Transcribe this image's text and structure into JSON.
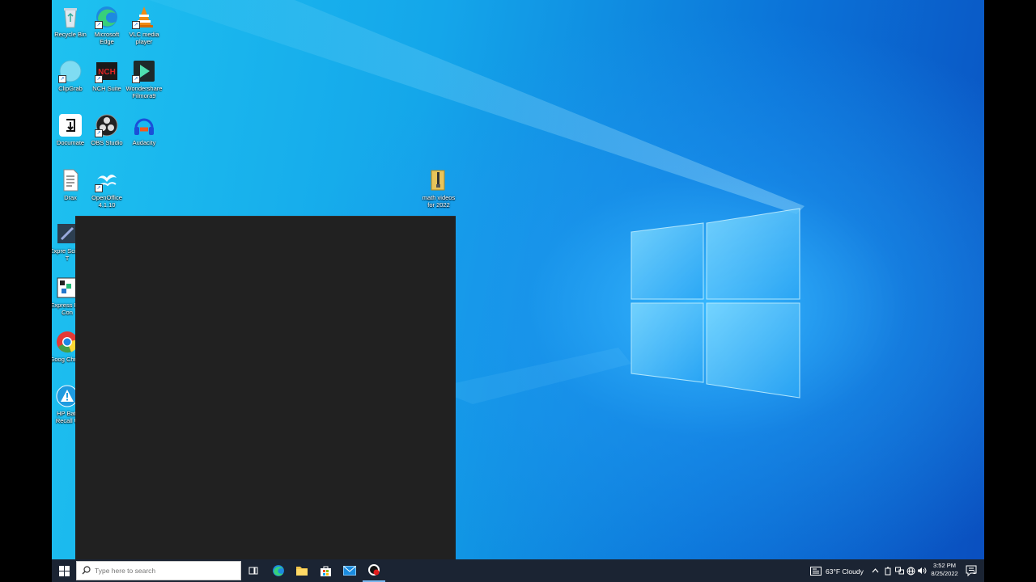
{
  "desktop": {
    "icons": [
      {
        "label": "Recycle Bin"
      },
      {
        "label": "Microsoft Edge"
      },
      {
        "label": "VLC media player"
      },
      {
        "label": "ClipGrab"
      },
      {
        "label": "NCH Suite"
      },
      {
        "label": "Wondershare Filmora9"
      },
      {
        "label": "Documate"
      },
      {
        "label": "OBS Studio"
      },
      {
        "label": "Audacity"
      },
      {
        "label": "Drax"
      },
      {
        "label": "OpenOffice 4.1.10"
      },
      {
        "label": "math videos for 2022"
      },
      {
        "label": "Expre Scribe T"
      },
      {
        "label": "Express File Con"
      },
      {
        "label": "Goog Chrom"
      },
      {
        "label": "HP Batt Recall U"
      }
    ]
  },
  "taskbar": {
    "search_placeholder": "Type here to search",
    "weather": "63°F Cloudy",
    "clock_time": "3:52 PM",
    "clock_date": "8/25/2022",
    "notification_count": "1"
  },
  "colors": {
    "taskbar": "#1b2433",
    "window": "#212121",
    "accent": "#0a73d8"
  }
}
